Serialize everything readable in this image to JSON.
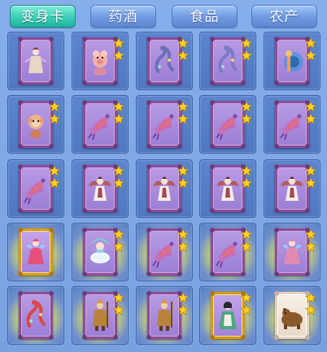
{
  "tabs": [
    {
      "label": "变身卡",
      "active": true
    },
    {
      "label": "药酒",
      "active": false
    },
    {
      "label": "食品",
      "active": false
    },
    {
      "label": "农产",
      "active": false
    }
  ],
  "colors": {
    "active_tab": "#3ed1b8",
    "tab": "#6f99de",
    "slot": "#5c86cc",
    "card_purple_frame": "#8a4e9c",
    "card_gold_frame": "#d49a1c",
    "star": "#ffd21f"
  },
  "items": [
    {
      "frame": "purple",
      "stars": 0,
      "creature": "girl-icon",
      "art": "#e7d7c4"
    },
    {
      "frame": "purple",
      "stars": 2,
      "creature": "pig-icon",
      "art": "#f2b1a8"
    },
    {
      "frame": "purple",
      "stars": 2,
      "creature": "dragon-icon",
      "art": "#6f6fb8"
    },
    {
      "frame": "purple",
      "stars": 2,
      "creature": "dragon-icon",
      "art": "#7b7ac9"
    },
    {
      "frame": "purple",
      "stars": 2,
      "creature": "peacock-icon",
      "art": "#4f92d9"
    },
    {
      "frame": "purple",
      "stars": 2,
      "creature": "monkey-icon",
      "art": "#f0b48a"
    },
    {
      "frame": "purple",
      "stars": 2,
      "creature": "bird-icon",
      "art": "#c66fb2"
    },
    {
      "frame": "purple",
      "stars": 2,
      "creature": "bird-icon",
      "art": "#c66fb2"
    },
    {
      "frame": "purple",
      "stars": 2,
      "creature": "bird-icon",
      "art": "#c66fb2"
    },
    {
      "frame": "purple",
      "stars": 2,
      "creature": "bird-icon",
      "art": "#c66fb2"
    },
    {
      "frame": "purple",
      "stars": 2,
      "creature": "bird-icon",
      "art": "#c66fb2"
    },
    {
      "frame": "purple",
      "stars": 2,
      "creature": "winged-girl-icon",
      "art": "#a0485a"
    },
    {
      "frame": "purple",
      "stars": 2,
      "creature": "winged-girl-icon",
      "art": "#a0485a"
    },
    {
      "frame": "purple",
      "stars": 2,
      "creature": "winged-girl-icon",
      "art": "#a0485a"
    },
    {
      "frame": "purple",
      "stars": 2,
      "creature": "winged-girl-icon",
      "art": "#a0485a"
    },
    {
      "frame": "gold",
      "stars": 0,
      "creature": "fairy-icon",
      "art": "#e6507a",
      "glow": true
    },
    {
      "frame": "purple",
      "stars": 2,
      "creature": "cloud-sprite-icon",
      "art": "#8fd0f0",
      "glow": true
    },
    {
      "frame": "purple",
      "stars": 2,
      "creature": "bird-icon",
      "art": "#c66fb2",
      "glow": true
    },
    {
      "frame": "purple",
      "stars": 2,
      "creature": "bird-icon",
      "art": "#c66fb2",
      "glow": true
    },
    {
      "frame": "purple",
      "stars": 2,
      "creature": "fairy-icon",
      "art": "#e08ab0",
      "glow": true
    },
    {
      "frame": "purple",
      "stars": 0,
      "creature": "dragon-icon",
      "art": "#d9484a",
      "glow": true
    },
    {
      "frame": "purple",
      "stars": 2,
      "creature": "warrior-icon",
      "art": "#b8843a",
      "glow": true
    },
    {
      "frame": "purple",
      "stars": 2,
      "creature": "warrior-icon",
      "art": "#b8843a",
      "glow": true
    },
    {
      "frame": "gold",
      "stars": 2,
      "creature": "lady-icon",
      "art": "#4ea77e",
      "glow": true
    },
    {
      "frame": "white",
      "stars": 2,
      "creature": "bear-icon",
      "art": "#8b5a2b",
      "glow": true
    }
  ]
}
